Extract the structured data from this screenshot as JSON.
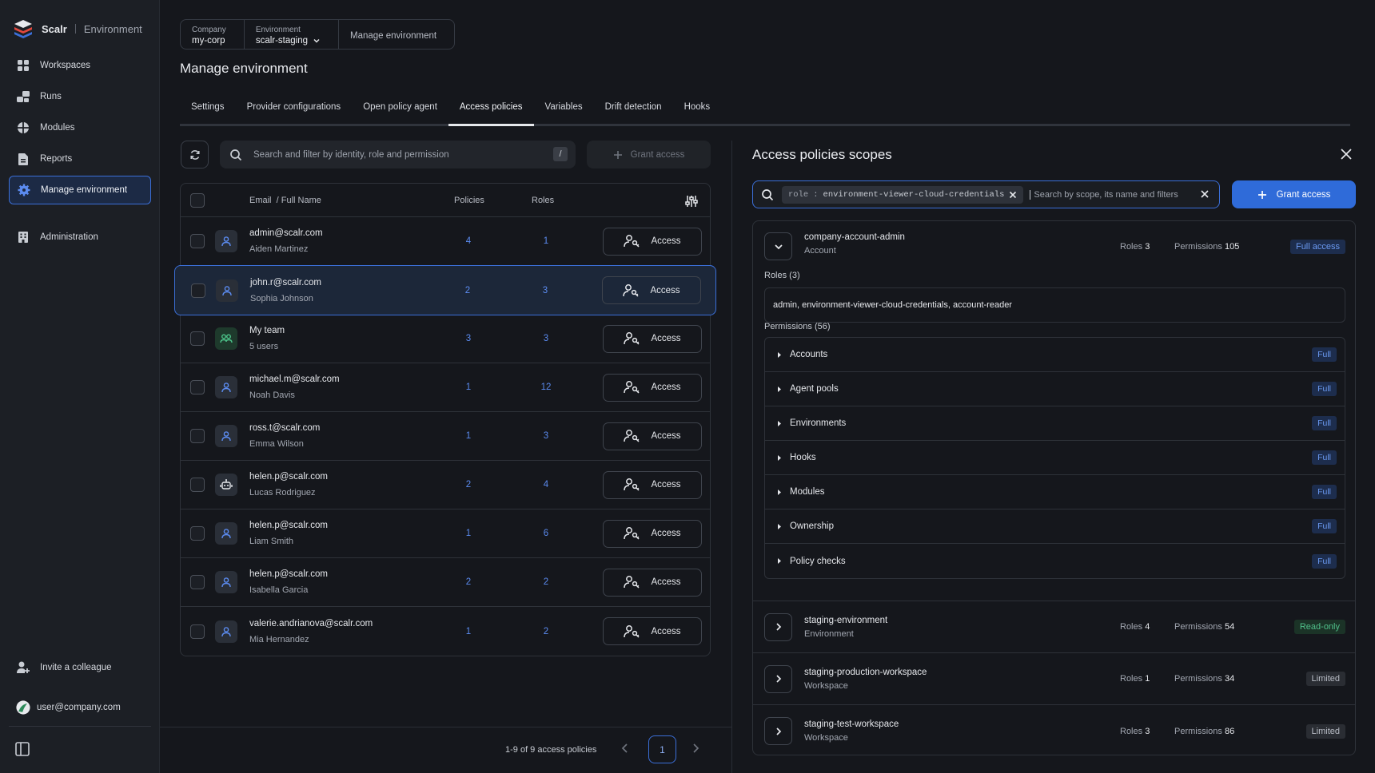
{
  "sidebar": {
    "brand": "Scalr",
    "brand_section": "Environment",
    "items": [
      {
        "label": "Workspaces",
        "icon": "grid-icon"
      },
      {
        "label": "Runs",
        "icon": "runs-icon"
      },
      {
        "label": "Modules",
        "icon": "modules-icon"
      },
      {
        "label": "Reports",
        "icon": "reports-icon"
      },
      {
        "label": "Manage environment",
        "icon": "gear-icon",
        "active": true
      },
      {
        "label": "Administration",
        "icon": "building-icon"
      }
    ],
    "invite": "Invite a colleague",
    "user": "user@company.com"
  },
  "breadcrumb": {
    "company_label": "Company",
    "company_value": "my-corp",
    "env_label": "Environment",
    "env_value": "scalr-staging",
    "current": "Manage environment"
  },
  "page_title": "Manage environment",
  "tabs": [
    "Settings",
    "Provider configurations",
    "Open policy agent",
    "Access policies",
    "Variables",
    "Drift detection",
    "Hooks"
  ],
  "active_tab": "Access policies",
  "left": {
    "search_placeholder": "Search and filter by identity, role and permission",
    "search_shortcut": "/",
    "grant_label": "Grant access",
    "columns": {
      "email": "Email",
      "name": "/ Full Name",
      "policies": "Policies",
      "roles": "Roles"
    },
    "access_label": "Access",
    "rows": [
      {
        "email": "admin@scalr.com",
        "name": "Aiden Martinez",
        "policies": "4",
        "roles": "1",
        "type": "user"
      },
      {
        "email": "john.r@scalr.com",
        "name": "Sophia Johnson",
        "policies": "2",
        "roles": "3",
        "type": "user",
        "selected": true
      },
      {
        "email": "My team",
        "name": "5 users",
        "policies": "3",
        "roles": "3",
        "type": "team"
      },
      {
        "email": "michael.m@scalr.com",
        "name": "Noah Davis",
        "policies": "1",
        "roles": "12",
        "type": "user"
      },
      {
        "email": "ross.t@scalr.com",
        "name": "Emma Wilson",
        "policies": "1",
        "roles": "3",
        "type": "user"
      },
      {
        "email": "helen.p@scalr.com",
        "name": "Lucas Rodriguez",
        "policies": "2",
        "roles": "4",
        "type": "robot"
      },
      {
        "email": "helen.p@scalr.com",
        "name": "Liam Smith",
        "policies": "1",
        "roles": "6",
        "type": "user"
      },
      {
        "email": "helen.p@scalr.com",
        "name": "Isabella Garcia",
        "policies": "2",
        "roles": "2",
        "type": "user"
      },
      {
        "email": "valerie.andrianova@scalr.com",
        "name": "Mia Hernandez",
        "policies": "1",
        "roles": "2",
        "type": "user"
      }
    ],
    "pager_text": "1-9 of 9 access policies",
    "current_page": "1"
  },
  "right": {
    "title": "Access policies scopes",
    "filter_key": "role",
    "filter_sep": ":",
    "filter_value": "environment-viewer-cloud-credentials",
    "search_placeholder": "Search by scope, its name and filters",
    "grant_label": "Grant access",
    "roles_label": "Roles",
    "permissions_label": "Permissions",
    "expanded": {
      "name": "company-account-admin",
      "type": "Account",
      "roles": "3",
      "permissions": "105",
      "badge": "Full access",
      "roles_heading": "Roles (3)",
      "roles_list": "admin, environment-viewer-cloud-credentials, account-reader",
      "perms_heading": "Permissions (56)",
      "perms": [
        {
          "label": "Accounts",
          "level": "Full"
        },
        {
          "label": "Agent pools",
          "level": "Full"
        },
        {
          "label": "Environments",
          "level": "Full"
        },
        {
          "label": "Hooks",
          "level": "Full"
        },
        {
          "label": "Modules",
          "level": "Full"
        },
        {
          "label": "Ownership",
          "level": "Full"
        },
        {
          "label": "Policy checks",
          "level": "Full"
        }
      ]
    },
    "scopes": [
      {
        "name": "staging-environment",
        "type": "Environment",
        "roles": "4",
        "permissions": "54",
        "badge": "Read-only"
      },
      {
        "name": "staging-production-workspace",
        "type": "Workspace",
        "roles": "1",
        "permissions": "34",
        "badge": "Limited"
      },
      {
        "name": "staging-test-workspace",
        "type": "Workspace",
        "roles": "3",
        "permissions": "86",
        "badge": "Limited"
      }
    ]
  },
  "colors": {
    "accent": "#2f6bd9",
    "background": "#15171c",
    "sidebar": "#1c1f25",
    "link": "#5b8bf0"
  }
}
